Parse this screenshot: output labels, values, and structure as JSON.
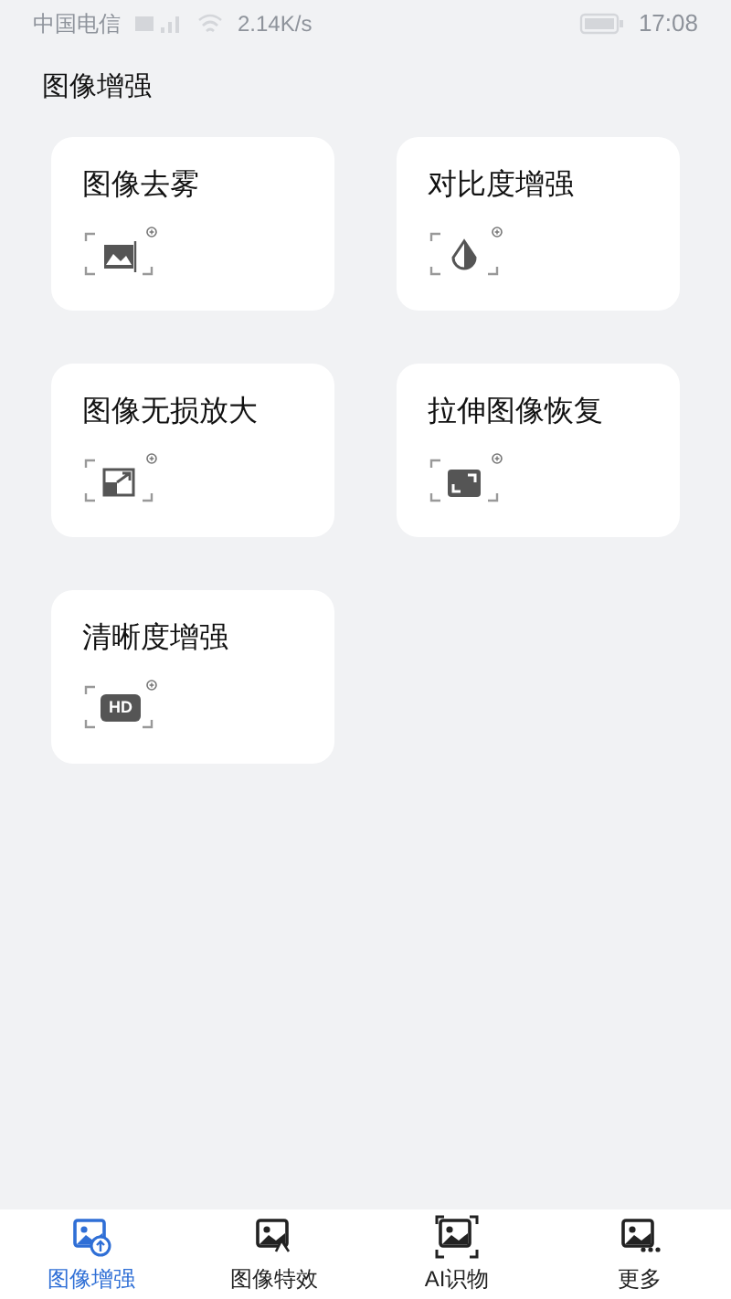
{
  "status_bar": {
    "carrier": "中国电信",
    "speed": "2.14K/s",
    "time": "17:08"
  },
  "page_title": "图像增强",
  "cards": [
    {
      "title": "图像去雾",
      "kind": "dehaze"
    },
    {
      "title": "对比度增强",
      "kind": "contrast"
    },
    {
      "title": "图像无损放大",
      "kind": "upscale"
    },
    {
      "title": "拉伸图像恢复",
      "kind": "stretch"
    },
    {
      "title": "清晰度增强",
      "kind": "hd",
      "badge": "HD"
    }
  ],
  "tabs": [
    {
      "label": "图像增强",
      "kind": "enhance",
      "selected": true
    },
    {
      "label": "图像特效",
      "kind": "effects",
      "selected": false
    },
    {
      "label": "AI识物",
      "kind": "recognize",
      "selected": false
    },
    {
      "label": "更多",
      "kind": "more",
      "selected": false
    }
  ]
}
